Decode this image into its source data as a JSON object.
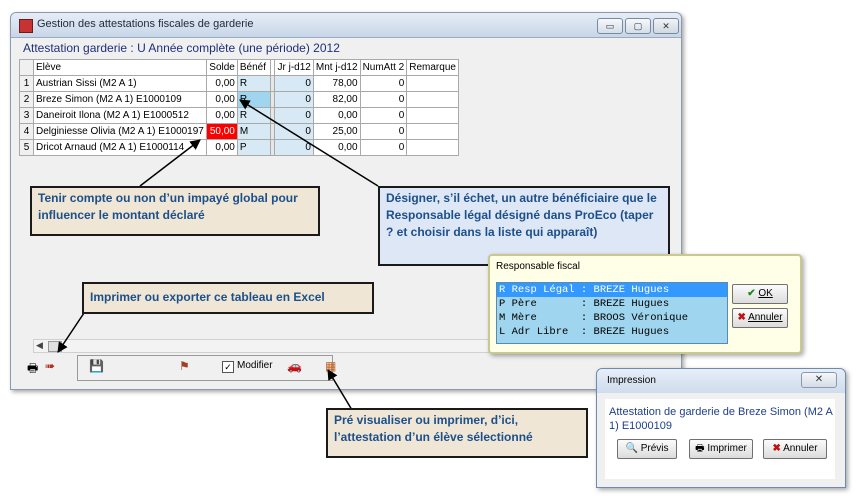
{
  "window": {
    "title": "Gestion des attestations fiscales de garderie",
    "subtitle": "Attestation garderie : U Année complète (une période) 2012",
    "btn_min": "▭",
    "btn_max": "▢",
    "btn_close": "✕"
  },
  "grid": {
    "headers": [
      "Elève",
      "Solde",
      "Bénéf",
      "Jr j-d12",
      "Mnt j-d12",
      "NumAtt 2",
      "Remarque"
    ],
    "rows": [
      {
        "n": "1",
        "eleve": "Austrian Sissi (M2 A 1)",
        "solde": "0,00",
        "benef": "R",
        "jr": "0",
        "mnt": "78,00",
        "numatt": "0",
        "remarque": ""
      },
      {
        "n": "2",
        "eleve": "Breze Simon (M2 A 1) E1000109",
        "solde": "0,00",
        "benef": "R",
        "jr": "0",
        "mnt": "82,00",
        "numatt": "0",
        "remarque": ""
      },
      {
        "n": "3",
        "eleve": "Daneiroit Ilona (M2 A 1) E1000512",
        "solde": "0,00",
        "benef": "R",
        "jr": "0",
        "mnt": "0,00",
        "numatt": "0",
        "remarque": ""
      },
      {
        "n": "4",
        "eleve": "Delginiesse Olivia (M2 A 1) E1000197",
        "solde": "50,00",
        "benef": "M",
        "jr": "0",
        "mnt": "25,00",
        "numatt": "0",
        "remarque": ""
      },
      {
        "n": "5",
        "eleve": "Dricot Arnaud (M2 A 1) E1000114",
        "solde": "0,00",
        "benef": "P",
        "jr": "0",
        "mnt": "0,00",
        "numatt": "0",
        "remarque": ""
      }
    ]
  },
  "toolbar": {
    "modifier_label": "Modifier",
    "modifier_checked": "✓"
  },
  "callouts": {
    "impaye": "Tenir compte ou non d’un impayé global pour influencer le montant déclaré",
    "beneficiaire": "Désigner, s’il échet, un autre bénéficiaire que le Responsable légal désigné dans ProEco (taper ? et choisir dans la liste qui apparaît)",
    "export": "Imprimer ou exporter ce tableau en Excel",
    "previsualiser": "Pré visualiser ou imprimer, d’ici, l’attestation d’un élève sélectionné"
  },
  "resp_dialog": {
    "title": "Responsable fiscal",
    "items": [
      "R Resp Légal : BREZE Hugues",
      "P Père       : BREZE Hugues",
      "M Mère       : BROOS Véronique",
      "L Adr Libre  : BREZE Hugues"
    ],
    "ok_label": "OK",
    "cancel_label": "Annuler"
  },
  "print_dialog": {
    "title": "Impression",
    "close_label": "✕",
    "text": "Attestation de garderie de Breze Simon (M2 A 1) E1000109",
    "previs_label": "Prévis",
    "imprimer_label": "Imprimer",
    "annuler_label": "Annuler"
  },
  "colors": {
    "accent_text": "#1d4f8a",
    "red_cell": "#ff0000",
    "beneficiary_cell": "#d6e9f5",
    "list_highlight": "#3399ff"
  }
}
